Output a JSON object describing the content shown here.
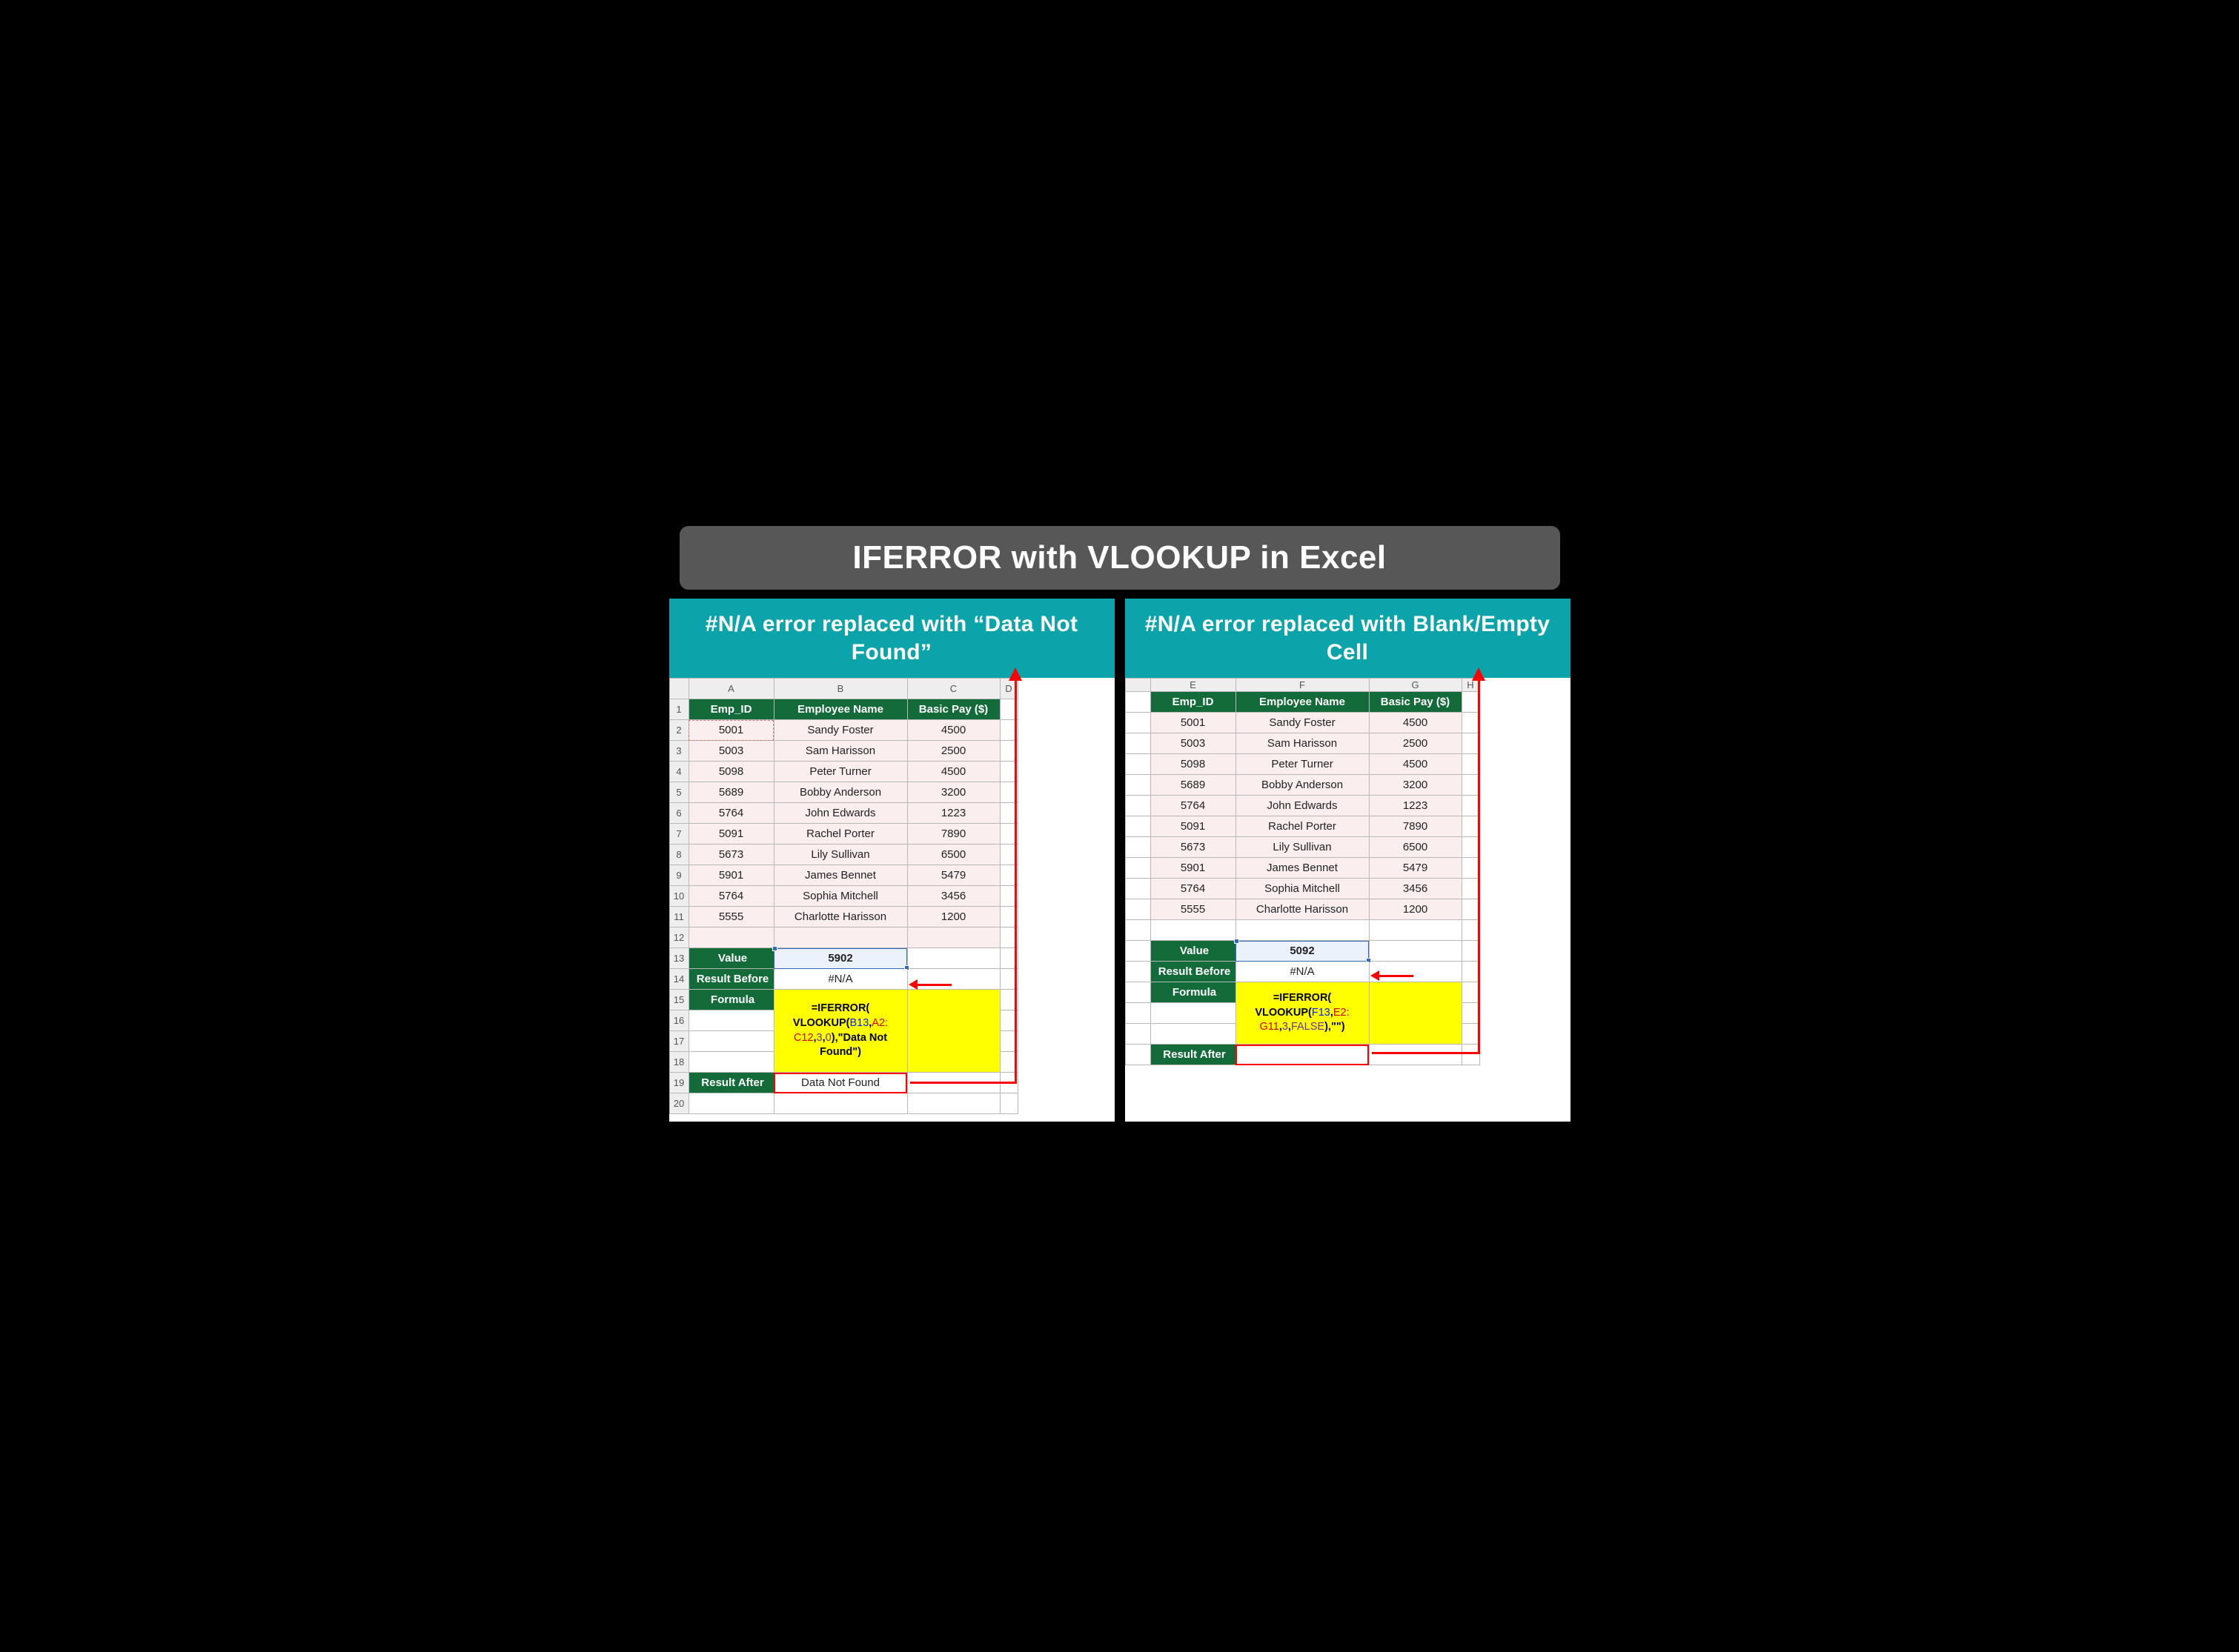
{
  "title": "IFERROR with VLOOKUP in Excel",
  "left": {
    "header": "#N/A error replaced with “Data Not Found”",
    "cols": [
      "A",
      "B",
      "C",
      "D"
    ],
    "table_headers": [
      "Emp_ID",
      "Employee Name",
      "Basic Pay ($)"
    ],
    "rows": [
      [
        "5001",
        "Sandy Foster",
        "4500"
      ],
      [
        "5003",
        "Sam Harisson",
        "2500"
      ],
      [
        "5098",
        "Peter Turner",
        "4500"
      ],
      [
        "5689",
        "Bobby Anderson",
        "3200"
      ],
      [
        "5764",
        "John Edwards",
        "1223"
      ],
      [
        "5091",
        "Rachel Porter",
        "7890"
      ],
      [
        "5673",
        "Lily Sullivan",
        "6500"
      ],
      [
        "5901",
        "James Bennet",
        "5479"
      ],
      [
        "5764",
        "Sophia Mitchell",
        "3456"
      ],
      [
        "5555",
        "Charlotte Harisson",
        "1200"
      ]
    ],
    "value_label": "Value",
    "value": "5902",
    "result_before_label": "Result Before",
    "result_before": "#N/A",
    "formula_label": "Formula",
    "formula_lines": {
      "l1_a": "=IFERROR(",
      "l2_a": "VLOOKUP(",
      "l2_b": "B13",
      "l2_c": ",",
      "l2_d": "A2:",
      "l3_a": "C12",
      "l3_b": ",",
      "l3_c": "3",
      "l3_d": ",",
      "l3_e": "0",
      "l3_f": "),\"Data Not",
      "l4_a": "Found\")"
    },
    "result_after_label": "Result After",
    "result_after": "Data Not Found"
  },
  "right": {
    "header": "#N/A error replaced with Blank/Empty Cell",
    "cols": [
      "E",
      "F",
      "G",
      "H"
    ],
    "table_headers": [
      "Emp_ID",
      "Employee Name",
      "Basic Pay ($)"
    ],
    "rows": [
      [
        "5001",
        "Sandy Foster",
        "4500"
      ],
      [
        "5003",
        "Sam Harisson",
        "2500"
      ],
      [
        "5098",
        "Peter Turner",
        "4500"
      ],
      [
        "5689",
        "Bobby Anderson",
        "3200"
      ],
      [
        "5764",
        "John Edwards",
        "1223"
      ],
      [
        "5091",
        "Rachel Porter",
        "7890"
      ],
      [
        "5673",
        "Lily Sullivan",
        "6500"
      ],
      [
        "5901",
        "James Bennet",
        "5479"
      ],
      [
        "5764",
        "Sophia Mitchell",
        "3456"
      ],
      [
        "5555",
        "Charlotte Harisson",
        "1200"
      ]
    ],
    "value_label": "Value",
    "value": "5092",
    "result_before_label": "Result Before",
    "result_before": "#N/A",
    "formula_label": "Formula",
    "formula_lines": {
      "l1_a": "=IFERROR(",
      "l2_a": "VLOOKUP(",
      "l2_b": "F13",
      "l2_c": ",",
      "l2_d": "E2:",
      "l3_a": "G11",
      "l3_b": ",",
      "l3_c": "3",
      "l3_d": ",",
      "l3_e": "FALSE",
      "l3_f": "),\"\")"
    },
    "result_after_label": "Result After",
    "result_after": ""
  },
  "row_numbers": [
    "1",
    "2",
    "3",
    "4",
    "5",
    "6",
    "7",
    "8",
    "9",
    "10",
    "11",
    "12",
    "13",
    "14",
    "15",
    "16",
    "17",
    "18",
    "19",
    "20"
  ]
}
